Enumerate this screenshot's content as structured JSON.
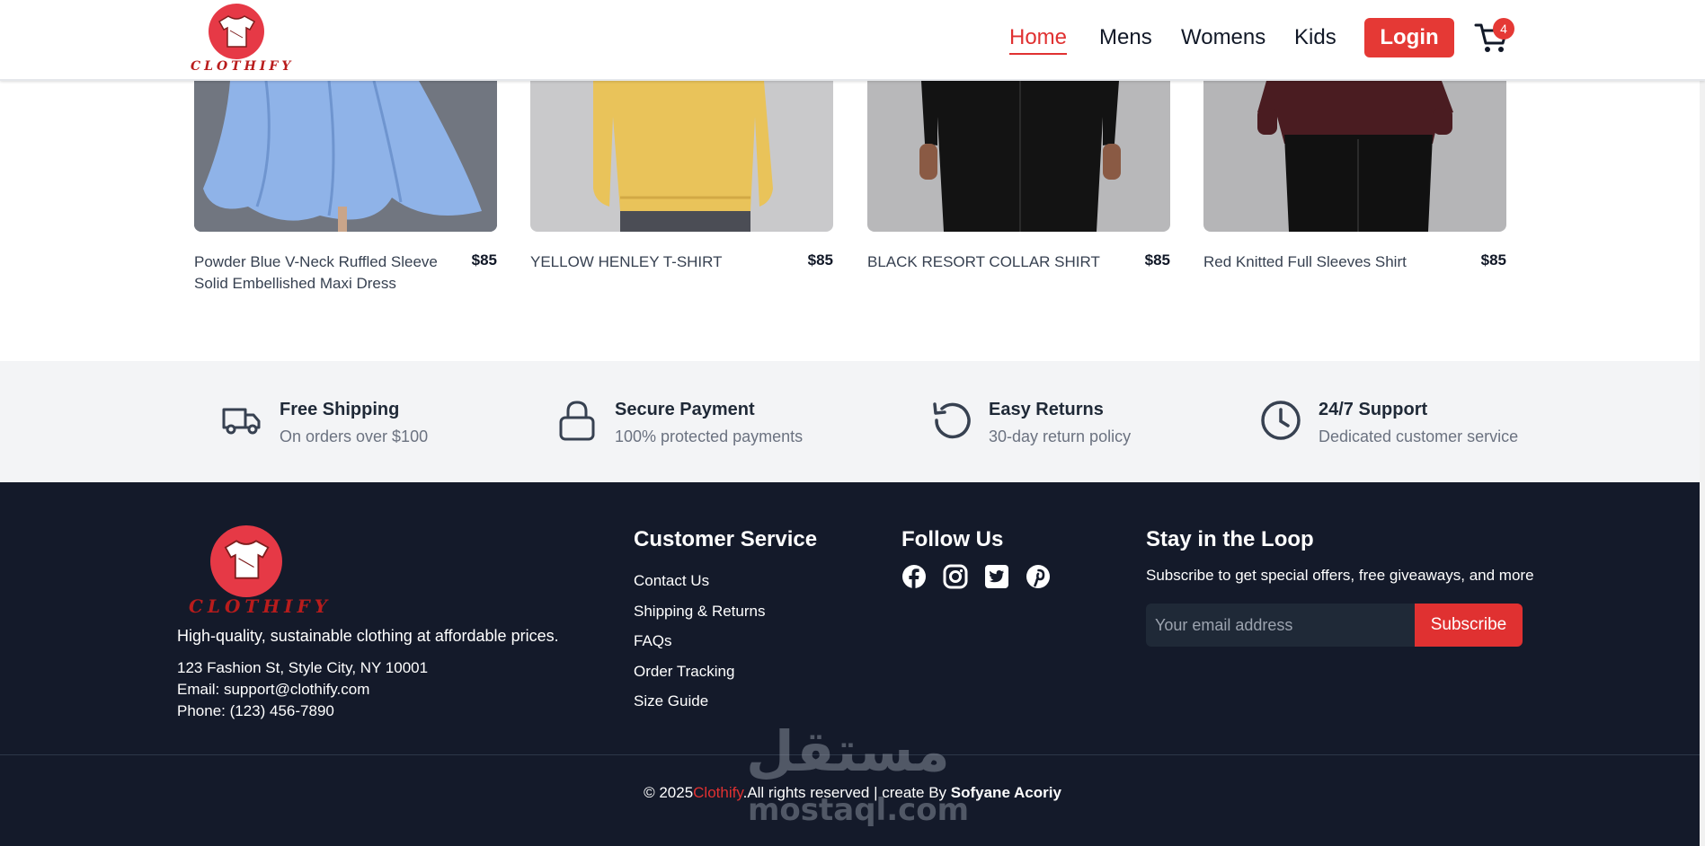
{
  "header": {
    "logo_text": "CLOTHIFY",
    "nav": [
      {
        "label": "Home",
        "active": true
      },
      {
        "label": "Mens",
        "active": false
      },
      {
        "label": "Womens",
        "active": false
      },
      {
        "label": "Kids",
        "active": false
      }
    ],
    "login_label": "Login",
    "cart_count": "4"
  },
  "products": [
    {
      "name": "Powder Blue V-Neck Ruffled Sleeve Solid Embellished Maxi Dress",
      "price": "$85"
    },
    {
      "name": "YELLOW HENLEY T-SHIRT",
      "price": "$85"
    },
    {
      "name": "BLACK RESORT COLLAR SHIRT",
      "price": "$85"
    },
    {
      "name": "Red Knitted Full Sleeves Shirt",
      "price": "$85"
    }
  ],
  "features": [
    {
      "icon": "truck-icon",
      "title": "Free Shipping",
      "subtitle": "On orders over $100"
    },
    {
      "icon": "lock-icon",
      "title": "Secure Payment",
      "subtitle": "100% protected payments"
    },
    {
      "icon": "rotate-icon",
      "title": "Easy Returns",
      "subtitle": "30-day return policy"
    },
    {
      "icon": "clock-icon",
      "title": "24/7 Support",
      "subtitle": "Dedicated customer service"
    }
  ],
  "footer": {
    "logo_text": "CLOTHIFY",
    "tagline": "High-quality, sustainable clothing at affordable prices.",
    "address": "123 Fashion St, Style City, NY 10001",
    "email": "Email: support@clothify.com",
    "phone": "Phone: (123) 456-7890",
    "customer_service": {
      "title": "Customer Service",
      "links": [
        "Contact Us",
        "Shipping & Returns",
        "FAQs",
        "Order Tracking",
        "Size Guide"
      ]
    },
    "follow_us": {
      "title": "Follow Us",
      "icons": [
        "facebook-icon",
        "instagram-icon",
        "twitter-icon",
        "pinterest-icon"
      ]
    },
    "newsletter": {
      "title": "Stay in the Loop",
      "subtitle": "Subscribe to get special offers, free giveaways, and more",
      "placeholder": "Your email address",
      "button": "Subscribe"
    },
    "copyright": {
      "prefix": "© 2025",
      "brand": "Clothify",
      "middle": ".All rights reserved | create By ",
      "author": "Sofyane Acoriy"
    }
  },
  "watermark": {
    "arabic": "مستقل",
    "latin": "mostaql.com"
  },
  "colors": {
    "accent": "#e03131",
    "footer_bg": "#141a2a",
    "features_bg": "#f3f4f6"
  }
}
